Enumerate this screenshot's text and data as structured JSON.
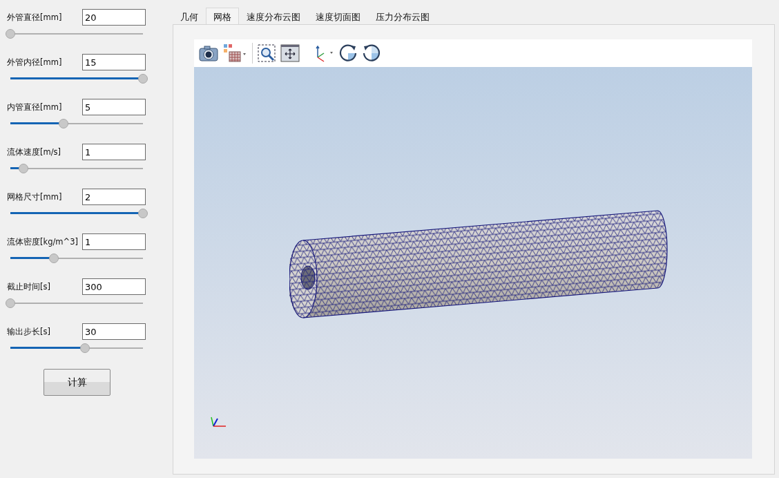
{
  "parameters": [
    {
      "label": "外管直径[mm]",
      "value": "20",
      "level": 0
    },
    {
      "label": "外管内径[mm]",
      "value": "15",
      "level": 1
    },
    {
      "label": "内管直径[mm]",
      "value": "5",
      "level": 0.4
    },
    {
      "label": "流体速度[m/s]",
      "value": "1",
      "level": 0.1
    },
    {
      "label": "网格尺寸[mm]",
      "value": "2",
      "level": 1
    },
    {
      "label": "流体密度[kg/m^3]",
      "value": "1",
      "level": 0.33
    },
    {
      "label": "截止时间[s]",
      "value": "300",
      "level": 0
    },
    {
      "label": "输出步长[s]",
      "value": "30",
      "level": 0.56
    }
  ],
  "compute_button": "计算",
  "tabs": [
    {
      "label": "几何",
      "selected": false
    },
    {
      "label": "网格",
      "selected": true
    },
    {
      "label": "速度分布云图",
      "selected": false
    },
    {
      "label": "速度切面图",
      "selected": false
    },
    {
      "label": "压力分布云图",
      "selected": false
    }
  ]
}
